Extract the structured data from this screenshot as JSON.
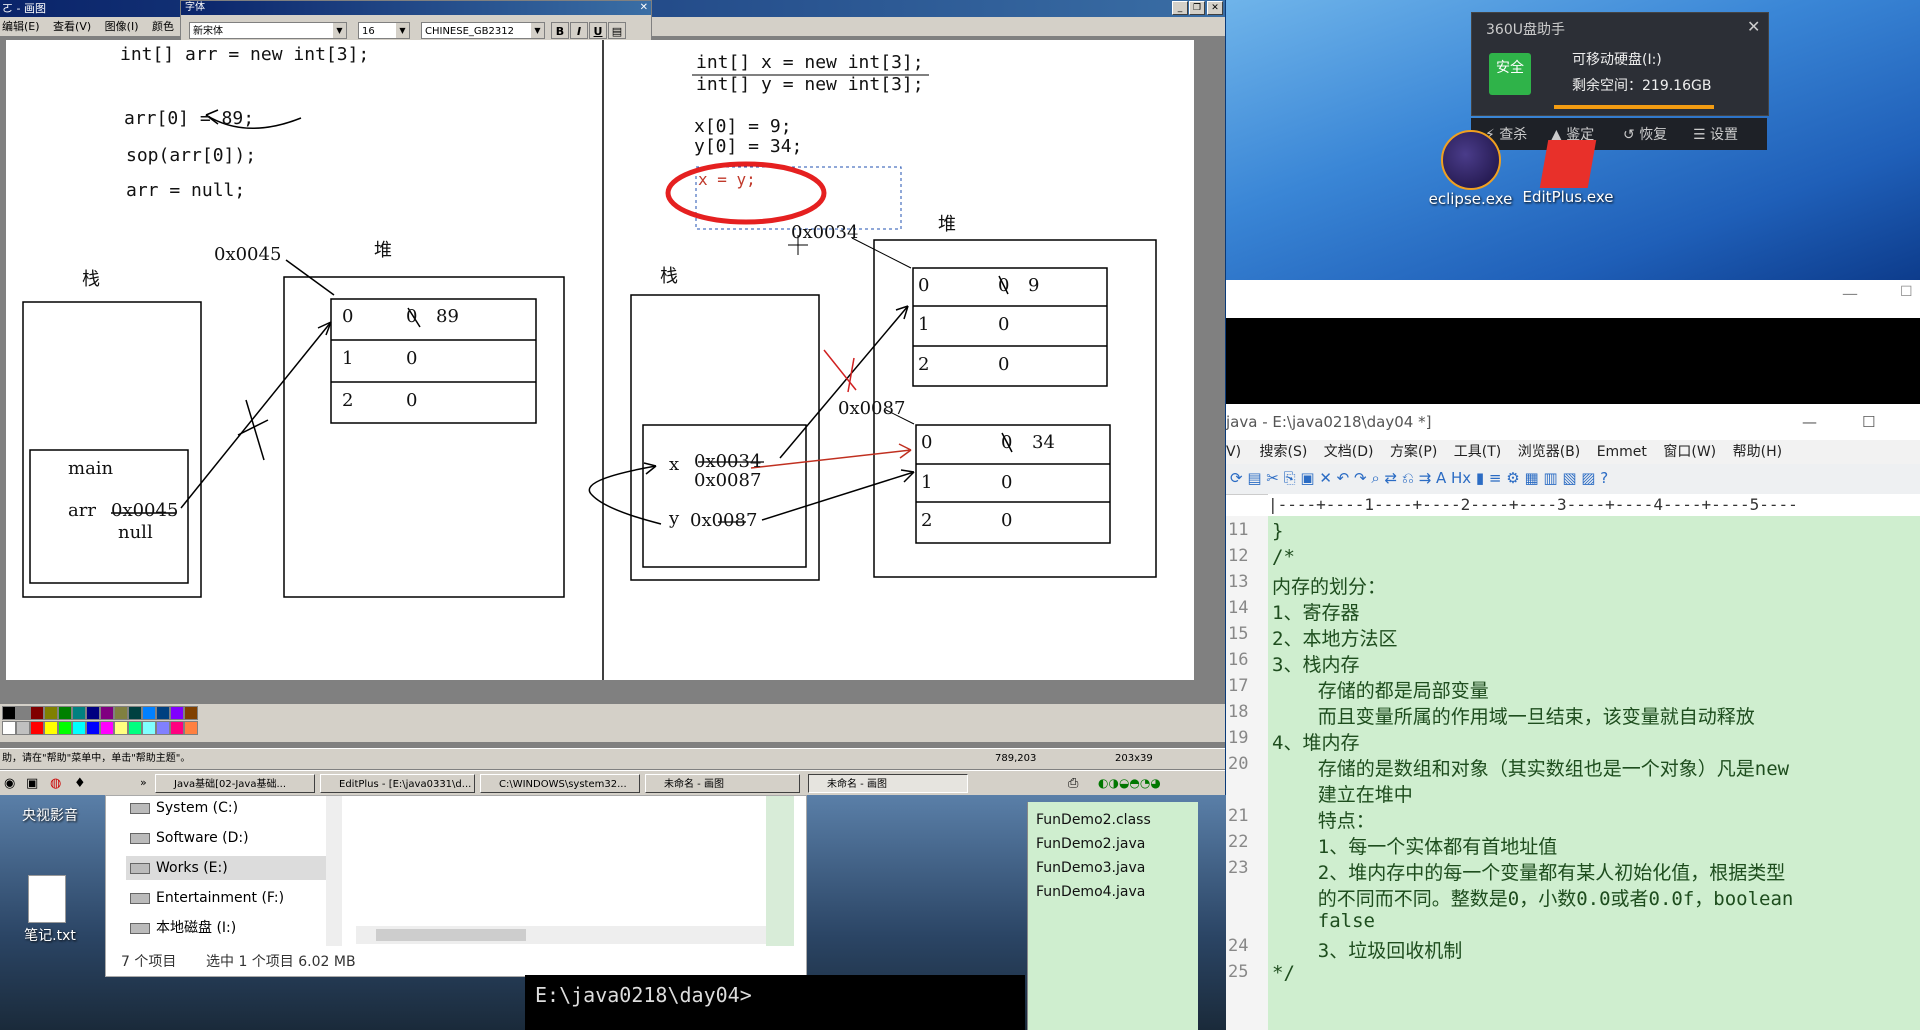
{
  "paint": {
    "title": "ㄛ - 画图",
    "menu": [
      "编辑(E)",
      "查看(V)",
      "图像(I)",
      "颜色"
    ],
    "font_toolbar": {
      "title": "字体",
      "font_name": "新宋体",
      "font_size": "16",
      "charset": "CHINESE_GB2312",
      "bold": "B",
      "italic": "I",
      "underline": "U"
    },
    "status_hint": "助，请在\"帮助\"菜单中，单击\"帮助主题\"。",
    "status_coords": "789,203",
    "status_size": "203x39",
    "palette_colors": [
      "#000000",
      "#808080",
      "#800000",
      "#808000",
      "#008000",
      "#008080",
      "#000080",
      "#800080",
      "#808040",
      "#004040",
      "#0080ff",
      "#004080",
      "#8000ff",
      "#804000",
      "#ffffff",
      "#c0c0c0",
      "#ff0000",
      "#ffff00",
      "#00ff00",
      "#00ffff",
      "#0000ff",
      "#ff00ff",
      "#ffff80",
      "#00ff80",
      "#80ffff",
      "#8080ff",
      "#ff0080",
      "#ff8040"
    ],
    "sketch_left": {
      "code": [
        "int[] arr = new int[3];",
        "arr[0] = 89;",
        "sop(arr[0]);",
        "arr = null;"
      ],
      "stack_label": "栈",
      "heap_label": "堆",
      "address": "0x0045",
      "main_label": "main",
      "arr_label": "arr",
      "arr_old": "0x0045",
      "arr_new": "null",
      "rows": [
        {
          "idx": "0",
          "old": "0",
          "val": "89"
        },
        {
          "idx": "1",
          "val": "0"
        },
        {
          "idx": "2",
          "val": "0"
        }
      ]
    },
    "sketch_right": {
      "code": [
        "int[] x = new int[3];",
        "int[] y = new int[3];",
        "x[0] = 9;",
        "y[0] = 34;",
        "x = y;"
      ],
      "stack_label": "栈",
      "heap_label": "堆",
      "address1": "0x0034",
      "address2": "0x0087",
      "x_label": "x",
      "x_old": "0x0034",
      "x_new": "0x0087",
      "y_label": "y",
      "y_val": "0x0087",
      "rows1": [
        {
          "idx": "0",
          "old": "0",
          "val": "9"
        },
        {
          "idx": "1",
          "val": "0"
        },
        {
          "idx": "2",
          "val": "0"
        }
      ],
      "rows2": [
        {
          "idx": "0",
          "old": "0",
          "val": "34"
        },
        {
          "idx": "1",
          "val": "0"
        },
        {
          "idx": "2",
          "val": "0"
        }
      ]
    }
  },
  "taskbar": {
    "items": [
      "Java基础[02-Java基础...",
      "EditPlus - [E:\\java0331\\d...",
      "C:\\WINDOWS\\system32...",
      "未命名 - 画图",
      "未命名 - 画图"
    ]
  },
  "u_helper": {
    "title": "360U盘助手",
    "badge": "安全",
    "drive": "可移动硬盘(I:)",
    "free": "剩余空间：219.16GB",
    "actions": [
      "查杀",
      "鉴定",
      "恢复",
      "设置"
    ]
  },
  "desktop_icons": [
    "eclipse.exe",
    "EditPlus.exe",
    "央视影音",
    "笔记.txt"
  ],
  "editplus": {
    "title": "java - E:\\java0218\\day04 *]",
    "menu": [
      "V)",
      "搜索(S)",
      "文档(D)",
      "方案(P)",
      "工具(T)",
      "浏览器(B)",
      "Emmet",
      "窗口(W)",
      "帮助(H)"
    ],
    "ruler": "|----+----1----+----2----+----3----+----4----+----5----",
    "lines": [
      {
        "n": "11",
        "text": "}"
      },
      {
        "n": "12",
        "text": "/*"
      },
      {
        "n": "13",
        "text": "内存的划分："
      },
      {
        "n": "14",
        "text": "1、寄存器"
      },
      {
        "n": "15",
        "text": "2、本地方法区"
      },
      {
        "n": "16",
        "text": "3、栈内存"
      },
      {
        "n": "17",
        "text": "    存储的都是局部变量"
      },
      {
        "n": "18",
        "text": "    而且变量所属的作用域一旦结束，该变量就自动释放"
      },
      {
        "n": "19",
        "text": "4、堆内存"
      },
      {
        "n": "20",
        "text": "    存储的是数组和对象（其实数组也是一个对象）凡是new"
      },
      {
        "n": "",
        "text": "    建立在堆中"
      },
      {
        "n": "21",
        "text": "    特点："
      },
      {
        "n": "22",
        "text": "    1、每一个实体都有首地址值"
      },
      {
        "n": "23",
        "text": "    2、堆内存中的每一个变量都有某人初始化值，根据类型"
      },
      {
        "n": "",
        "text": "    的不同而不同。整数是0，小数0.0或者0.0f，boolean"
      },
      {
        "n": "",
        "text": "    false"
      },
      {
        "n": "24",
        "text": "    3、垃圾回收机制"
      },
      {
        "n": "25",
        "text": "*/"
      }
    ]
  },
  "explorer": {
    "drives": [
      "System (C:)",
      "Software (D:)",
      "Works (E:)",
      "Entertainment (F:)",
      "本地磁盘 (I:)"
    ],
    "status_count": "7 个项目",
    "status_selected": "选中 1 个项目  6.02 MB",
    "files": [
      "FunDemo2.class",
      "FunDemo2.java",
      "FunDemo3.java",
      "FunDemo4.java"
    ]
  },
  "cmd": {
    "prompt": "E:\\java0218\\day04>"
  }
}
